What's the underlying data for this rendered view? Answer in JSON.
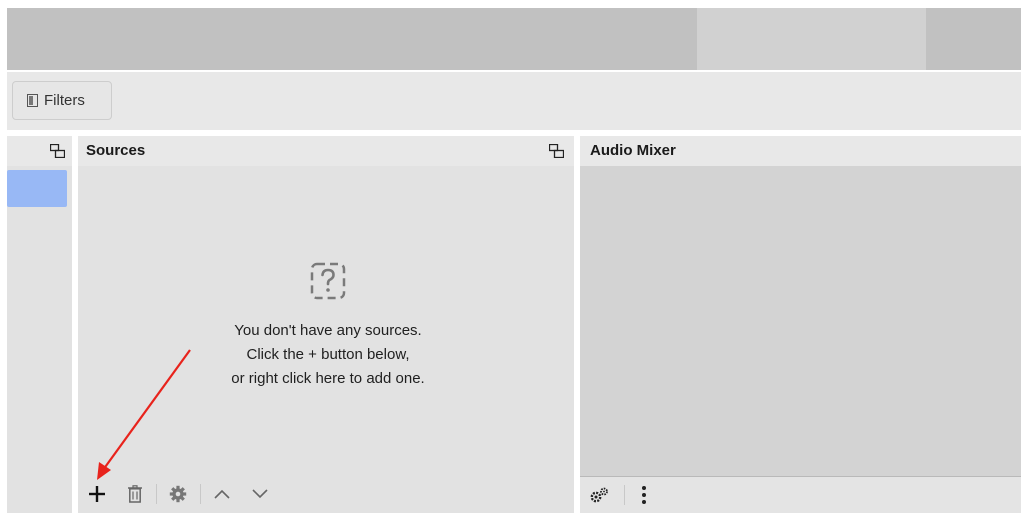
{
  "toolbar": {
    "filters_label": "Filters"
  },
  "sources": {
    "title": "Sources",
    "empty_lines": [
      "You don't have any sources.",
      "Click the + button below,",
      "or right click here to add one."
    ]
  },
  "audio_mixer": {
    "title": "Audio Mixer"
  },
  "icons": {
    "add": "plus-icon",
    "remove": "trash-icon",
    "properties": "gear-icon",
    "move_up": "chevron-up-icon",
    "move_down": "chevron-down-icon",
    "advanced_audio": "gears-icon",
    "menu": "vertical-ellipsis-icon",
    "float": "undock-icon",
    "empty": "question-icon",
    "annotation": "red-arrow"
  },
  "colors": {
    "selected_scene": "#98b8f5",
    "annotation_arrow": "#e8231c"
  }
}
